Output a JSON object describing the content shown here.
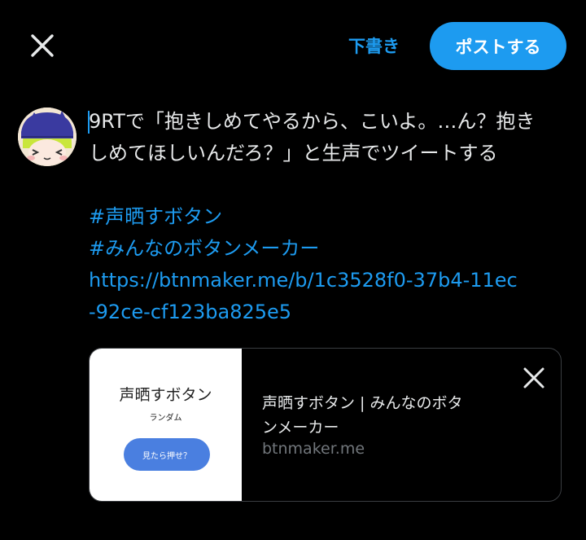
{
  "header": {
    "close_icon": "close-icon",
    "drafts_label": "下書き",
    "post_label": "ポストする",
    "accent_color": "#1d9bf0"
  },
  "avatar": {
    "icon": "avatar-image"
  },
  "compose": {
    "line1": "9RTで「抱きしめてやるから、こいよ。…ん？抱き",
    "line2": "しめてほしいんだろ？」と生声でツイートする",
    "hashtag1": "#声晒すボタン",
    "hashtag2": "#みんなのボタンメーカー",
    "url_line1": "https://btnmaker.me/b/1c3528f0-37b4-11ec",
    "url_line2": "-92ce-cf123ba825e5"
  },
  "link_card": {
    "thumbnail_title": "声晒すボタン",
    "thumbnail_subtitle": "ランダム",
    "thumbnail_button": "見たら押せ？",
    "title_line1": "声晒すボタン | みんなのボタ",
    "title_line2": "ンメーカー",
    "domain": "btnmaker.me",
    "close_icon": "close-icon"
  }
}
